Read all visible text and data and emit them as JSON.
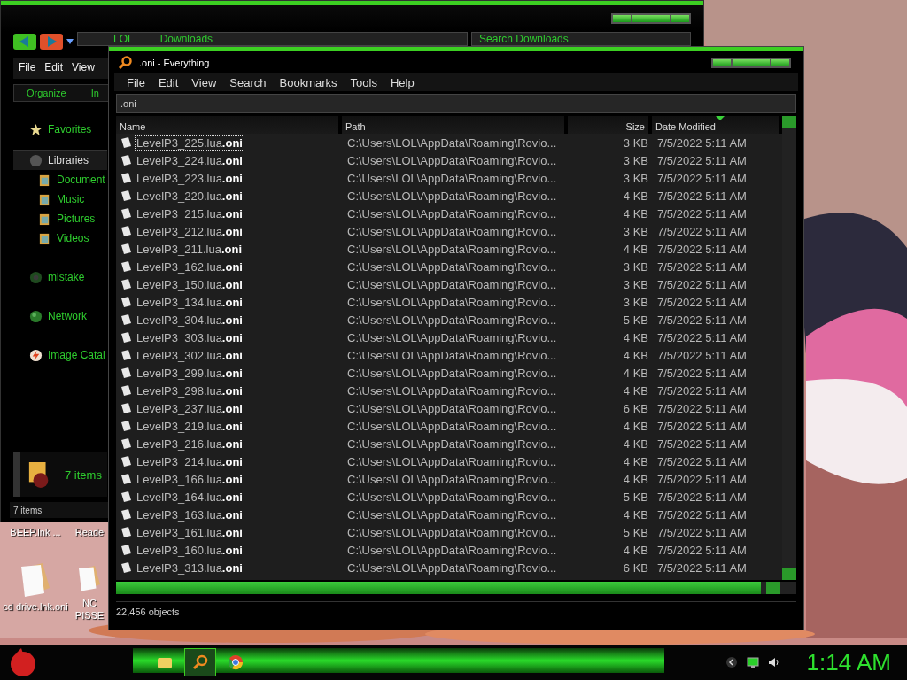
{
  "explorer": {
    "address": [
      "LOL",
      "Downloads"
    ],
    "search": {
      "placeholder": "Search Downloads"
    },
    "menu": [
      "File",
      "Edit",
      "View"
    ],
    "toolbar": [
      "Organize",
      "In"
    ],
    "sidebar": [
      {
        "label": "Favorites",
        "kind": "favorites"
      },
      {
        "label": "Libraries",
        "kind": "libraries"
      },
      {
        "label": "Document",
        "kind": "library"
      },
      {
        "label": "Music",
        "kind": "library"
      },
      {
        "label": "Pictures",
        "kind": "library"
      },
      {
        "label": "Videos",
        "kind": "library"
      },
      {
        "label": "mistake",
        "kind": "drive"
      },
      {
        "label": "Network",
        "kind": "network"
      },
      {
        "label": "Image Catal",
        "kind": "app"
      }
    ],
    "details": "7 items",
    "status": "7 items"
  },
  "desktop_icons": [
    {
      "label": "BEEP.lnk ...",
      "kind": "cut"
    },
    {
      "label": "Reade",
      "kind": "cut"
    },
    {
      "label": "cd drive.lnk.oni",
      "kind": "file"
    },
    {
      "label": "NC PISSE",
      "kind": "file"
    }
  ],
  "everything": {
    "title": ".oni - Everything",
    "menu": [
      "File",
      "Edit",
      "View",
      "Search",
      "Bookmarks",
      "Tools",
      "Help"
    ],
    "search": {
      "value": ".oni"
    },
    "columns": [
      {
        "label": "Name",
        "sorted": false
      },
      {
        "label": "Path",
        "sorted": false
      },
      {
        "label": "Size",
        "sorted": false
      },
      {
        "label": "Date Modified",
        "sorted": true
      }
    ],
    "rows": [
      {
        "name": "LevelP3_225.lua**.oni**",
        "path": "C:\\Users\\LOL\\AppData\\Roaming\\Rovio...",
        "size": "3 KB",
        "date": "7/5/2022 5:11 AM",
        "selected": true
      },
      {
        "name": "LevelP3_224.lua**.oni**",
        "path": "C:\\Users\\LOL\\AppData\\Roaming\\Rovio...",
        "size": "3 KB",
        "date": "7/5/2022 5:11 AM",
        "selected": false
      },
      {
        "name": "LevelP3_223.lua**.oni**",
        "path": "C:\\Users\\LOL\\AppData\\Roaming\\Rovio...",
        "size": "3 KB",
        "date": "7/5/2022 5:11 AM",
        "selected": false
      },
      {
        "name": "LevelP3_220.lua**.oni**",
        "path": "C:\\Users\\LOL\\AppData\\Roaming\\Rovio...",
        "size": "4 KB",
        "date": "7/5/2022 5:11 AM",
        "selected": false
      },
      {
        "name": "LevelP3_215.lua**.oni**",
        "path": "C:\\Users\\LOL\\AppData\\Roaming\\Rovio...",
        "size": "4 KB",
        "date": "7/5/2022 5:11 AM",
        "selected": false
      },
      {
        "name": "LevelP3_212.lua**.oni**",
        "path": "C:\\Users\\LOL\\AppData\\Roaming\\Rovio...",
        "size": "3 KB",
        "date": "7/5/2022 5:11 AM",
        "selected": false
      },
      {
        "name": "LevelP3_211.lua**.oni**",
        "path": "C:\\Users\\LOL\\AppData\\Roaming\\Rovio...",
        "size": "4 KB",
        "date": "7/5/2022 5:11 AM",
        "selected": false
      },
      {
        "name": "LevelP3_162.lua**.oni**",
        "path": "C:\\Users\\LOL\\AppData\\Roaming\\Rovio...",
        "size": "3 KB",
        "date": "7/5/2022 5:11 AM",
        "selected": false
      },
      {
        "name": "LevelP3_150.lua**.oni**",
        "path": "C:\\Users\\LOL\\AppData\\Roaming\\Rovio...",
        "size": "3 KB",
        "date": "7/5/2022 5:11 AM",
        "selected": false
      },
      {
        "name": "LevelP3_134.lua**.oni**",
        "path": "C:\\Users\\LOL\\AppData\\Roaming\\Rovio...",
        "size": "3 KB",
        "date": "7/5/2022 5:11 AM",
        "selected": false
      },
      {
        "name": "LevelP3_304.lua**.oni**",
        "path": "C:\\Users\\LOL\\AppData\\Roaming\\Rovio...",
        "size": "5 KB",
        "date": "7/5/2022 5:11 AM",
        "selected": false
      },
      {
        "name": "LevelP3_303.lua**.oni**",
        "path": "C:\\Users\\LOL\\AppData\\Roaming\\Rovio...",
        "size": "4 KB",
        "date": "7/5/2022 5:11 AM",
        "selected": false
      },
      {
        "name": "LevelP3_302.lua**.oni**",
        "path": "C:\\Users\\LOL\\AppData\\Roaming\\Rovio...",
        "size": "4 KB",
        "date": "7/5/2022 5:11 AM",
        "selected": false
      },
      {
        "name": "LevelP3_299.lua**.oni**",
        "path": "C:\\Users\\LOL\\AppData\\Roaming\\Rovio...",
        "size": "4 KB",
        "date": "7/5/2022 5:11 AM",
        "selected": false
      },
      {
        "name": "LevelP3_298.lua**.oni**",
        "path": "C:\\Users\\LOL\\AppData\\Roaming\\Rovio...",
        "size": "4 KB",
        "date": "7/5/2022 5:11 AM",
        "selected": false
      },
      {
        "name": "LevelP3_237.lua**.oni**",
        "path": "C:\\Users\\LOL\\AppData\\Roaming\\Rovio...",
        "size": "6 KB",
        "date": "7/5/2022 5:11 AM",
        "selected": false
      },
      {
        "name": "LevelP3_219.lua**.oni**",
        "path": "C:\\Users\\LOL\\AppData\\Roaming\\Rovio...",
        "size": "4 KB",
        "date": "7/5/2022 5:11 AM",
        "selected": false
      },
      {
        "name": "LevelP3_216.lua**.oni**",
        "path": "C:\\Users\\LOL\\AppData\\Roaming\\Rovio...",
        "size": "4 KB",
        "date": "7/5/2022 5:11 AM",
        "selected": false
      },
      {
        "name": "LevelP3_214.lua**.oni**",
        "path": "C:\\Users\\LOL\\AppData\\Roaming\\Rovio...",
        "size": "4 KB",
        "date": "7/5/2022 5:11 AM",
        "selected": false
      },
      {
        "name": "LevelP3_166.lua**.oni**",
        "path": "C:\\Users\\LOL\\AppData\\Roaming\\Rovio...",
        "size": "4 KB",
        "date": "7/5/2022 5:11 AM",
        "selected": false
      },
      {
        "name": "LevelP3_164.lua**.oni**",
        "path": "C:\\Users\\LOL\\AppData\\Roaming\\Rovio...",
        "size": "5 KB",
        "date": "7/5/2022 5:11 AM",
        "selected": false
      },
      {
        "name": "LevelP3_163.lua**.oni**",
        "path": "C:\\Users\\LOL\\AppData\\Roaming\\Rovio...",
        "size": "4 KB",
        "date": "7/5/2022 5:11 AM",
        "selected": false
      },
      {
        "name": "LevelP3_161.lua**.oni**",
        "path": "C:\\Users\\LOL\\AppData\\Roaming\\Rovio...",
        "size": "5 KB",
        "date": "7/5/2022 5:11 AM",
        "selected": false
      },
      {
        "name": "LevelP3_160.lua**.oni**",
        "path": "C:\\Users\\LOL\\AppData\\Roaming\\Rovio...",
        "size": "4 KB",
        "date": "7/5/2022 5:11 AM",
        "selected": false
      },
      {
        "name": "LevelP3_313.lua**.oni**",
        "path": "C:\\Users\\LOL\\AppData\\Roaming\\Rovio...",
        "size": "6 KB",
        "date": "7/5/2022 5:11 AM",
        "selected": false
      }
    ],
    "status": "22,456 objects"
  },
  "taskbar": {
    "tasks": [
      {
        "kind": "folder",
        "active": false
      },
      {
        "kind": "search",
        "active": true
      },
      {
        "kind": "browser",
        "active": false
      }
    ],
    "clock": "1:14 AM"
  }
}
